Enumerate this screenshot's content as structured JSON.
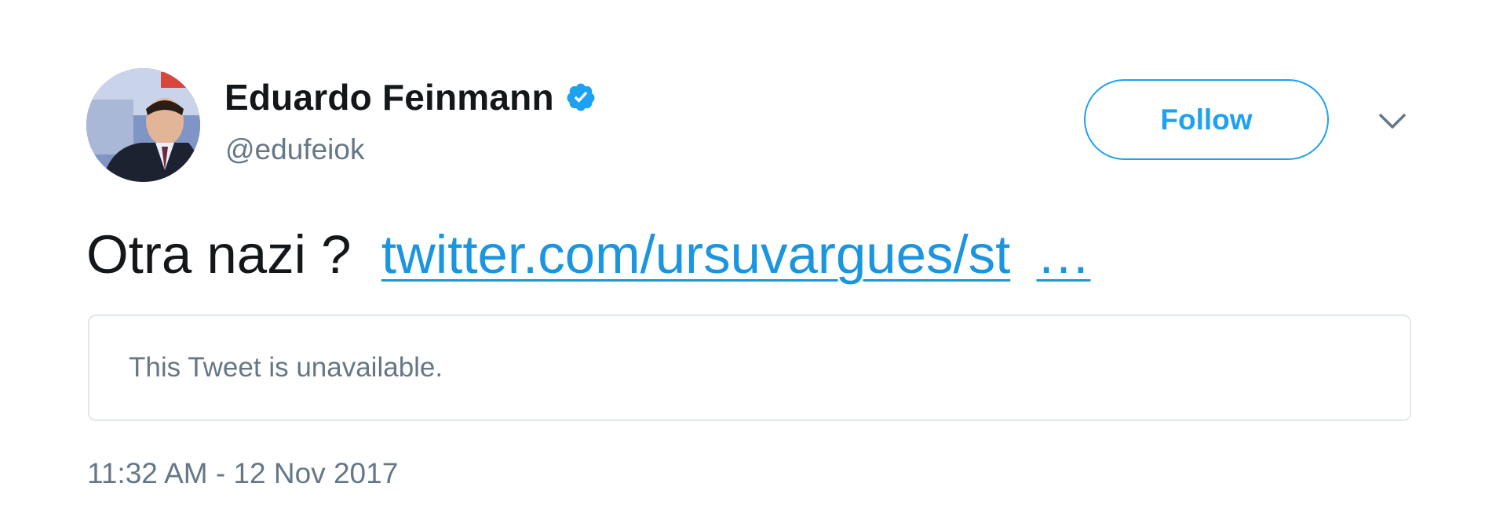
{
  "author": {
    "display_name": "Eduardo Feinmann",
    "handle": "@edufeiok",
    "verified": true
  },
  "actions": {
    "follow_label": "Follow"
  },
  "tweet": {
    "text_prefix": "Otra nazi ?",
    "link_text": "twitter.com/ursuvargues/st",
    "link_ellipsis": "…"
  },
  "quoted": {
    "message": "This Tweet is unavailable."
  },
  "meta": {
    "timestamp": "11:32 AM - 12 Nov 2017"
  },
  "colors": {
    "accent": "#1da1f2",
    "link": "#1b95e0",
    "secondary_text": "#657786",
    "border": "#e1e8ed"
  },
  "icons": {
    "verified": "verified-badge-icon",
    "caret": "chevron-down-icon"
  }
}
